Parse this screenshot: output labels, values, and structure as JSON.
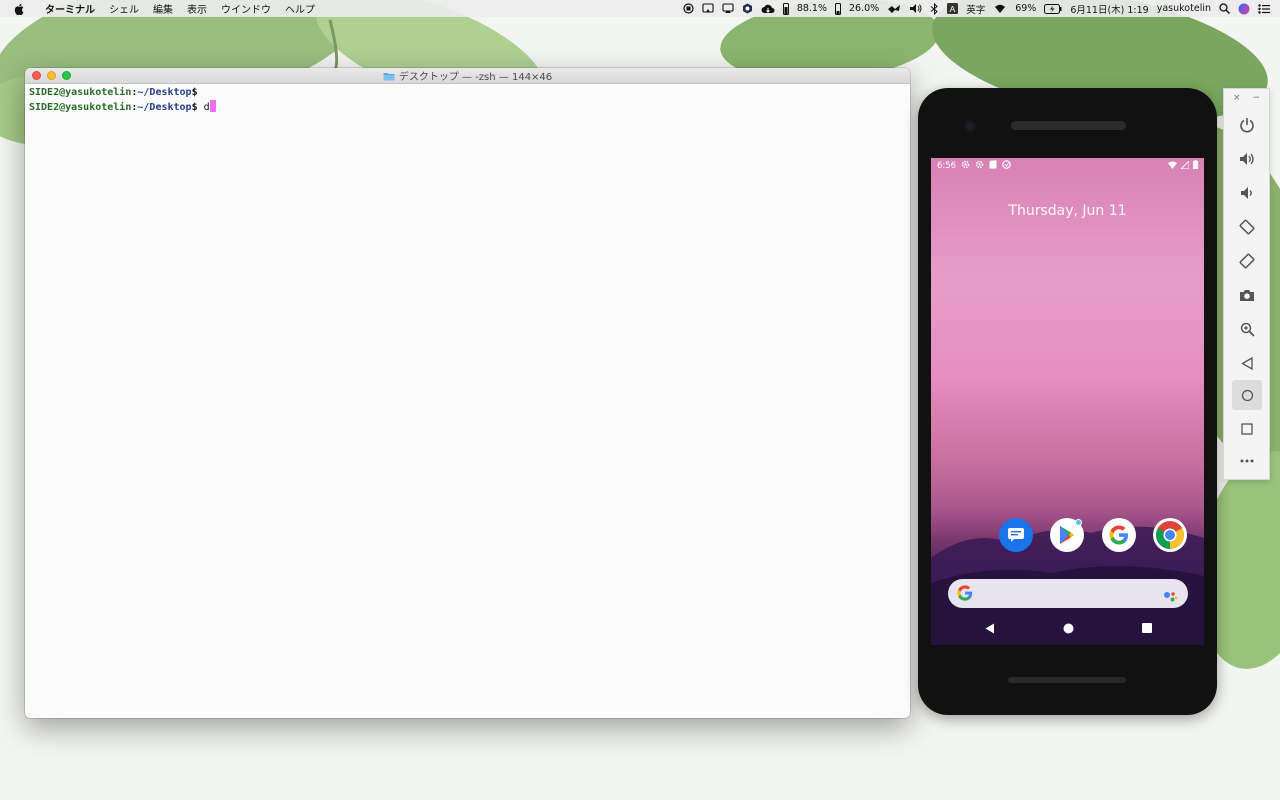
{
  "menubar": {
    "apple": "apple-icon",
    "items": [
      "ターミナル",
      "シェル",
      "編集",
      "表示",
      "ウインドウ",
      "ヘルプ"
    ],
    "battery_text_1": "88.1%",
    "battery_text_2": "26.0%",
    "input_method": "英字",
    "battery_percent": "69%",
    "datetime": "6月11日(木) 1:19",
    "user": "yasukotelin"
  },
  "terminal": {
    "title": "デスクトップ — -zsh — 144×46",
    "lines": [
      {
        "user": "SIDE2@yasukotelin",
        "sep": ":",
        "path": "~/Desktop",
        "dollar": "$",
        "input": ""
      },
      {
        "user": "SIDE2@yasukotelin",
        "sep": ":",
        "path": "~/Desktop",
        "dollar": "$",
        "input": " d"
      }
    ]
  },
  "phone": {
    "time": "6:56",
    "date": "Thursday, Jun 11",
    "dock_apps": [
      "messages-icon",
      "play-store-icon",
      "google-icon",
      "chrome-icon"
    ]
  },
  "emulator": {
    "close_label": "×",
    "minimize_label": "−",
    "buttons": [
      "power-icon",
      "volume-up-icon",
      "volume-down-icon",
      "rotate-left-icon",
      "rotate-right-icon",
      "camera-icon",
      "zoom-icon",
      "back-icon",
      "home-icon",
      "overview-icon",
      "more-icon"
    ]
  }
}
